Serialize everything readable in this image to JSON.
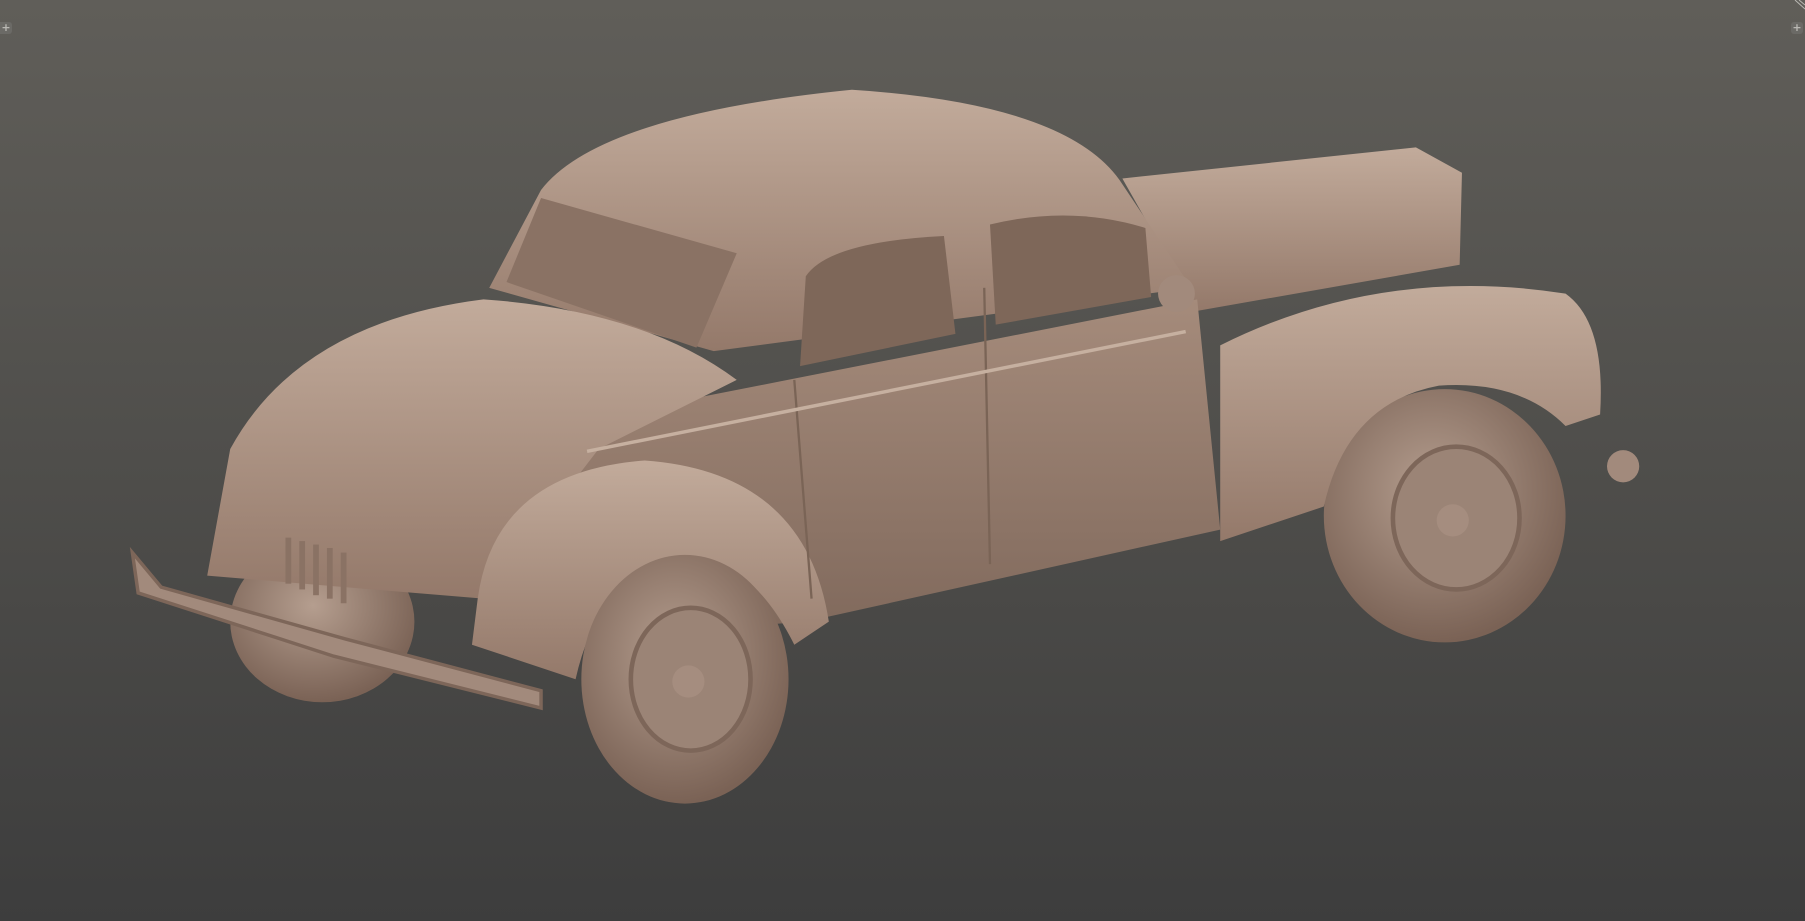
{
  "viewport": {
    "content": "3d-car-model",
    "colors": {
      "model": "#a89284",
      "background_top": "#605e59",
      "background_bottom": "#3d3d3d"
    }
  },
  "controls": {
    "left_button_icon": "plus-icon",
    "right_button_icon": "plus-icon",
    "left_button_glyph": "+",
    "right_button_glyph": "+"
  }
}
